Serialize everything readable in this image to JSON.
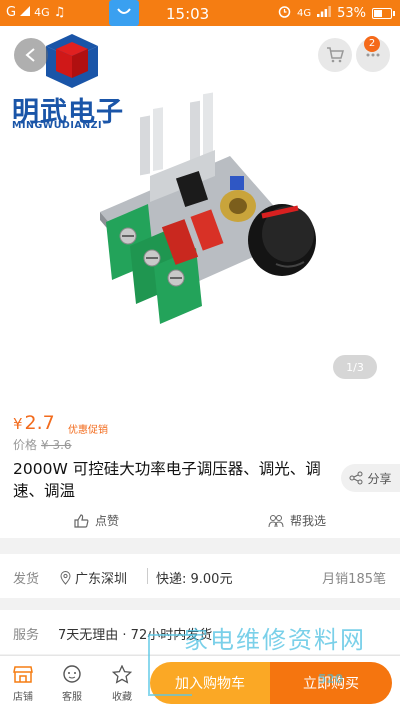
{
  "status_bar": {
    "signal": "G",
    "network": "4G",
    "time": "15:03",
    "network_right": "4G",
    "battery_percent": "53%",
    "battery_level": 0.53
  },
  "logo": {
    "cn": "明武电子",
    "en": "MINGWUDIANZI"
  },
  "header": {
    "cart_badge": "2"
  },
  "gallery": {
    "page_indicator": "1/3"
  },
  "product": {
    "currency": "¥",
    "price": "2.7",
    "promo_label": "优惠促销",
    "original_label": "价格",
    "original_price": "¥ 3.6",
    "title": "2000W 可控硅大功率电子调压器、调光、调速、调温",
    "share_label": "分享",
    "like_label": "点赞",
    "help_label": "帮我选"
  },
  "shipping": {
    "label": "发货",
    "location": "广东深圳",
    "fee": "快递: 9.00元",
    "sales": "月销185笔"
  },
  "service": {
    "label": "服务",
    "value": "7天无理由 · 72小时内发货"
  },
  "bottom_bar": {
    "shop_label": "店铺",
    "service_label": "客服",
    "fav_label": "收藏",
    "add_to_cart": "加入购物车",
    "buy_now": "立即购买"
  },
  "watermark": {
    "text": "家电维修资料网",
    "number": "520"
  },
  "colors": {
    "accent": "#f57d12",
    "price": "#f26b1d",
    "cart_button": "#fba825",
    "buy_button": "#f5750f",
    "logo_blue": "#1a55a8"
  }
}
